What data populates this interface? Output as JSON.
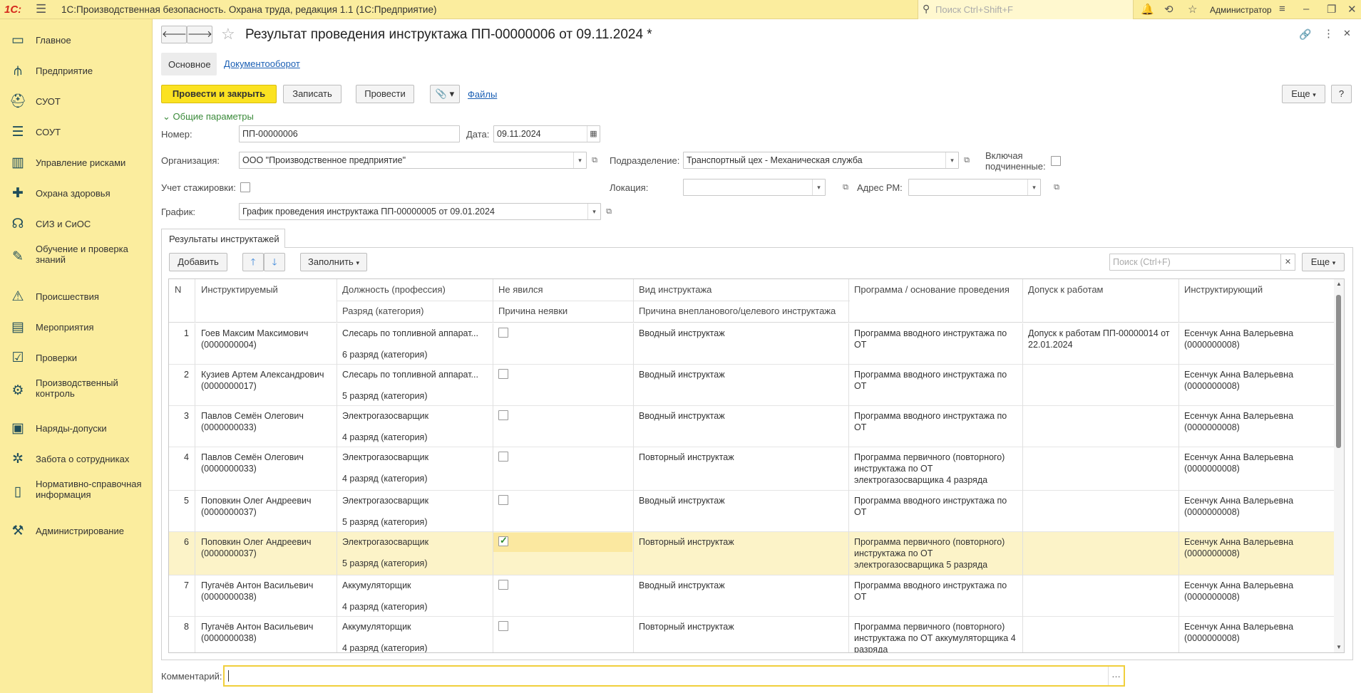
{
  "app": {
    "logo_text": "1С:",
    "title": "1С:Производственная безопасность. Охрана труда, редакция 1.1  (1С:Предприятие)",
    "search_placeholder": "Поиск Ctrl+Shift+F",
    "user": "Администратор"
  },
  "sidebar": {
    "items": [
      {
        "label": "Главное",
        "icon": "desktop-icon"
      },
      {
        "label": "Предприятие",
        "icon": "org-structure-icon"
      },
      {
        "label": "СУОТ",
        "icon": "worker-helmet-icon"
      },
      {
        "label": "СОУТ",
        "icon": "checklist-icon"
      },
      {
        "label": "Управление рисками",
        "icon": "risk-chart-icon"
      },
      {
        "label": "Охрана здоровья",
        "icon": "medical-cross-icon"
      },
      {
        "label": "СИЗ и СиОС",
        "icon": "protective-equipment-icon"
      },
      {
        "label": "Обучение и проверка знаний",
        "icon": "training-icon"
      },
      {
        "label": "Происшествия",
        "icon": "warning-triangle-icon"
      },
      {
        "label": "Мероприятия",
        "icon": "tasks-icon"
      },
      {
        "label": "Проверки",
        "icon": "clipboard-check-icon"
      },
      {
        "label": "Производственный контроль",
        "icon": "production-control-icon"
      },
      {
        "label": "Наряды-допуски",
        "icon": "permit-icon"
      },
      {
        "label": "Забота о сотрудниках",
        "icon": "care-gear-icon"
      },
      {
        "label": "Нормативно-справочная информация",
        "icon": "books-icon"
      },
      {
        "label": "Администрирование",
        "icon": "admin-icon"
      }
    ]
  },
  "document": {
    "title": "Результат проведения инструктажа ПП-00000006 от 09.11.2024 *",
    "tabs": {
      "main": "Основное",
      "docflow": "Документооборот"
    },
    "toolbar": {
      "post_close": "Провести и закрыть",
      "save": "Записать",
      "post": "Провести",
      "files": "Файлы",
      "more": "Еще",
      "help": "?"
    },
    "section_title": "Общие параметры",
    "fields": {
      "number_label": "Номер:",
      "number_value": "ПП-00000006",
      "date_label": "Дата:",
      "date_value": "09.11.2024",
      "org_label": "Организация:",
      "org_value": "ООО \"Производственное предприятие\"",
      "dept_label": "Подразделение:",
      "dept_value": "Транспортный цех - Механическая служба",
      "include_sub_label_1": "Включая",
      "include_sub_label_2": "подчиненные:",
      "internship_label": "Учет стажировки:",
      "location_label": "Локация:",
      "location_value": "",
      "workplace_label": "Адрес РМ:",
      "workplace_value": "",
      "schedule_label": "График:",
      "schedule_value": "График проведения инструктажа ПП-00000005 от 09.01.2024"
    },
    "results_tab": "Результаты инструктажей",
    "table_toolbar": {
      "add": "Добавить",
      "fill": "Заполнить",
      "search_placeholder": "Поиск (Ctrl+F)",
      "more": "Еще"
    },
    "columns": {
      "n": "N",
      "person": "Инструктируемый",
      "position": "Должность (профессия)",
      "grade": "Разряд (категория)",
      "absent": "Не явился",
      "absence_reason": "Причина неявки",
      "type": "Вид инструктажа",
      "unscheduled_reason": "Причина внепланового/целевого инструктажа",
      "program": "Программа / основание проведения",
      "permit": "Допуск к работам",
      "instructor": "Инструктирующий"
    },
    "rows": [
      {
        "n": "1",
        "person": "Гоев Максим Максимович (0000000004)",
        "position": "Слесарь по топливной аппарат...",
        "grade": "6 разряд (категория)",
        "absent": false,
        "type": "Вводный инструктаж",
        "program": "Программа вводного инструктажа по ОТ",
        "permit": "Допуск к работам ПП-00000014 от 22.01.2024",
        "instructor": "Есенчук Анна Валерьевна (0000000008)"
      },
      {
        "n": "2",
        "person": "Кузиев Артем Александрович (0000000017)",
        "position": "Слесарь по топливной аппарат...",
        "grade": "5 разряд (категория)",
        "absent": false,
        "type": "Вводный инструктаж",
        "program": "Программа вводного инструктажа по ОТ",
        "permit": "",
        "instructor": "Есенчук Анна Валерьевна (0000000008)"
      },
      {
        "n": "3",
        "person": "Павлов Семён Олегович (0000000033)",
        "position": "Электрогазосварщик",
        "grade": "4 разряд (категория)",
        "absent": false,
        "type": "Вводный инструктаж",
        "program": "Программа вводного инструктажа по ОТ",
        "permit": "",
        "instructor": "Есенчук Анна Валерьевна (0000000008)"
      },
      {
        "n": "4",
        "person": "Павлов Семён Олегович (0000000033)",
        "position": "Электрогазосварщик",
        "grade": "4 разряд (категория)",
        "absent": false,
        "type": "Повторный инструктаж",
        "program": "Программа первичного (повторного) инструктажа по ОТ электрогазосварщика 4 разряда",
        "permit": "",
        "instructor": "Есенчук Анна Валерьевна (0000000008)"
      },
      {
        "n": "5",
        "person": "Поповкин Олег Андреевич (0000000037)",
        "position": "Электрогазосварщик",
        "grade": "5 разряд (категория)",
        "absent": false,
        "type": "Вводный инструктаж",
        "program": "Программа вводного инструктажа по ОТ",
        "permit": "",
        "instructor": "Есенчук Анна Валерьевна (0000000008)"
      },
      {
        "n": "6",
        "person": "Поповкин Олег Андреевич (0000000037)",
        "position": "Электрогазосварщик",
        "grade": "5 разряд (категория)",
        "absent": true,
        "type": "Повторный инструктаж",
        "program": "Программа первичного (повторного) инструктажа по ОТ электрогазосварщика 5 разряда",
        "permit": "",
        "instructor": "Есенчук Анна Валерьевна (0000000008)"
      },
      {
        "n": "7",
        "person": "Пугачёв Антон Васильевич (0000000038)",
        "position": "Аккумуляторщик",
        "grade": "4 разряд (категория)",
        "absent": false,
        "type": "Вводный инструктаж",
        "program": "Программа вводного инструктажа по ОТ",
        "permit": "",
        "instructor": "Есенчук Анна Валерьевна (0000000008)"
      },
      {
        "n": "8",
        "person": "Пугачёв Антон Васильевич (0000000038)",
        "position": "Аккумуляторщик",
        "grade": "4 разряд (категория)",
        "absent": false,
        "type": "Повторный инструктаж",
        "program": "Программа первичного (повторного) инструктажа по ОТ аккумуляторщика 4 разряда",
        "permit": "",
        "instructor": "Есенчук Анна Валерьевна (0000000008)"
      }
    ],
    "comment_label": "Комментарий:",
    "comment_value": ""
  }
}
